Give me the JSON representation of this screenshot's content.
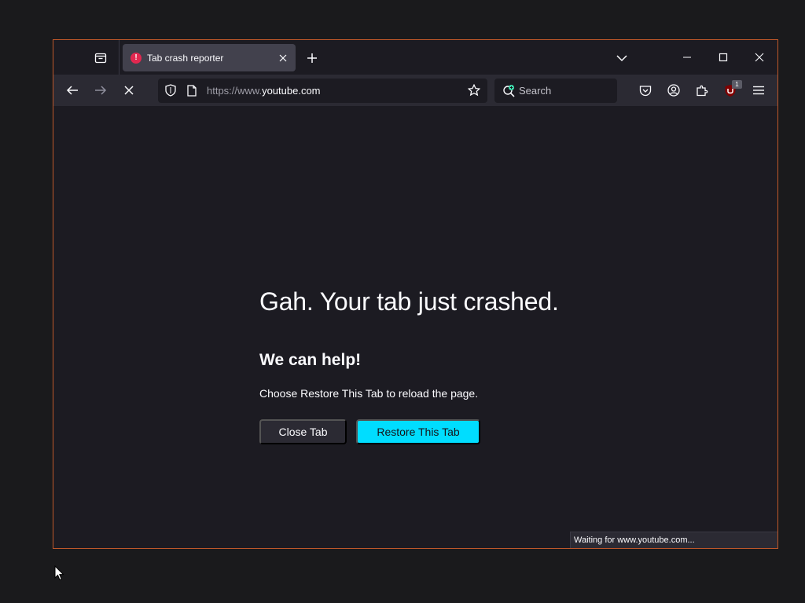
{
  "tab": {
    "title": "Tab crash reporter",
    "error_icon_glyph": "!"
  },
  "urlbar": {
    "prefix": "https://www.",
    "domain": "youtube.com"
  },
  "searchbar": {
    "placeholder": "Search"
  },
  "extensions": {
    "ublock_badge": "1"
  },
  "crash": {
    "title": "Gah. Your tab just crashed.",
    "subtitle": "We can help!",
    "description": "Choose Restore This Tab to reload the page.",
    "close_button": "Close Tab",
    "restore_button": "Restore This Tab"
  },
  "status_bar": {
    "text": "Waiting for www.youtube.com..."
  },
  "icons": [
    "firefox-view-icon",
    "error-icon",
    "close-icon",
    "plus-icon",
    "chevron-down-icon",
    "minimize-icon",
    "maximize-icon",
    "close-window-icon",
    "back-arrow-icon",
    "forward-arrow-icon",
    "stop-icon",
    "shield-icon",
    "page-icon",
    "star-icon",
    "search-icon",
    "pocket-icon",
    "account-icon",
    "extensions-icon",
    "ublock-icon",
    "hamburger-menu-icon",
    "mouse-cursor-icon"
  ],
  "colors": {
    "accent": "#00ddff",
    "window_border": "#c0582a",
    "background": "#1c1b22",
    "toolbar": "#2b2a33",
    "tab_selected": "#42414d",
    "error_badge": "#e22850"
  }
}
